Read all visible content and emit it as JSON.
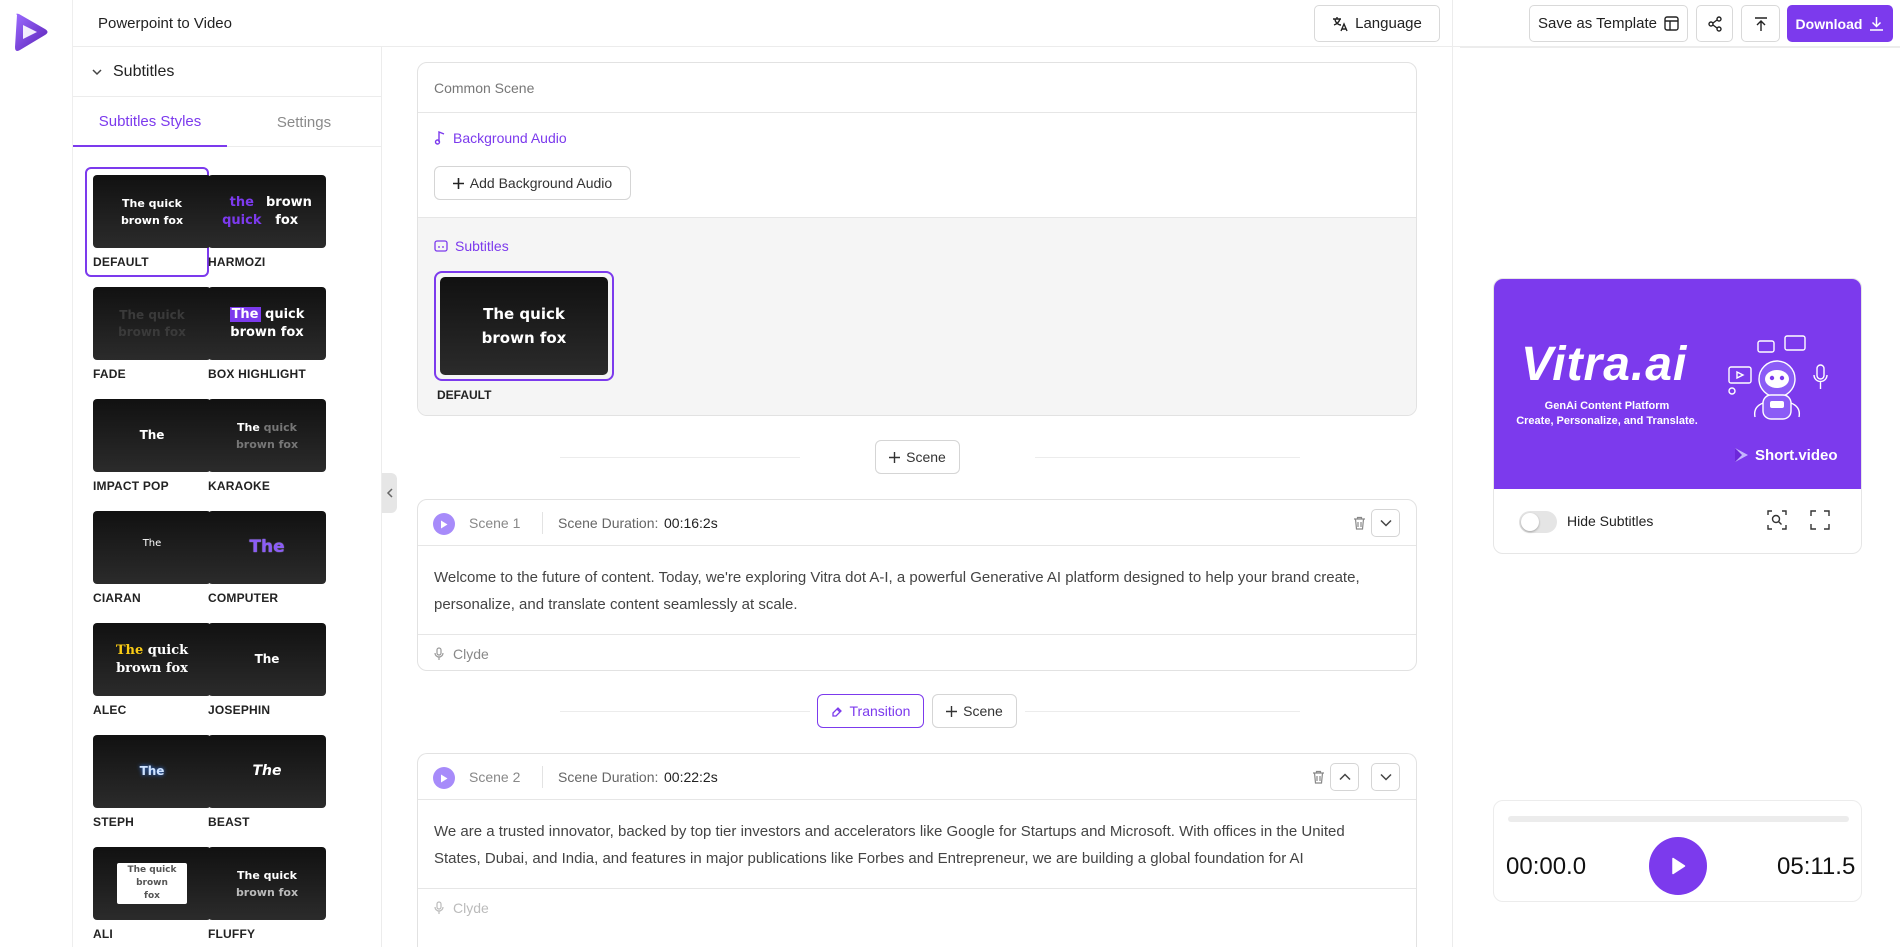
{
  "header": {
    "project_title": "Powerpoint to Video",
    "language_label": "Language",
    "save_template_label": "Save as Template",
    "download_label": "Download"
  },
  "left_panel": {
    "section_title": "Subtitles",
    "tabs": [
      {
        "label": "Subtitles Styles",
        "active": true
      },
      {
        "label": "Settings",
        "active": false
      }
    ],
    "styles": [
      {
        "name": "DEFAULT",
        "preview": "The quick brown fox",
        "selected": true
      },
      {
        "name": "HARMOZI",
        "preview": "the quick brown fox"
      },
      {
        "name": "FADE",
        "preview": "The quick brown fox"
      },
      {
        "name": "BOX HIGHLIGHT",
        "preview": "The quick brown fox"
      },
      {
        "name": "IMPACT POP",
        "preview": "The"
      },
      {
        "name": "KARAOKE",
        "preview": "The quick brown fox"
      },
      {
        "name": "CIARAN",
        "preview": "The"
      },
      {
        "name": "COMPUTER",
        "preview": "The"
      },
      {
        "name": "ALEC",
        "preview": "The quick brown fox"
      },
      {
        "name": "JOSEPHIN",
        "preview": "The"
      },
      {
        "name": "STEPH",
        "preview": "The"
      },
      {
        "name": "BEAST",
        "preview": "The"
      },
      {
        "name": "ALI",
        "preview": "The quick brown fox"
      },
      {
        "name": "FLUFFY",
        "preview": "The quick brown fox"
      }
    ]
  },
  "common_scene": {
    "title": "Common Scene",
    "background_audio_label": "Background Audio",
    "add_audio_label": "Add Background Audio",
    "subtitles_label": "Subtitles",
    "selected_style_preview": "The quick brown fox",
    "selected_style_name": "DEFAULT"
  },
  "add_scene_label": "Scene",
  "transition_label": "Transition",
  "scenes": [
    {
      "name": "Scene 1",
      "duration_label": "Scene Duration:",
      "duration": "00:16:2s",
      "text": "Welcome to the future of content. Today, we're exploring Vitra dot A-I, a powerful Generative AI platform designed to help your brand create, personalize, and translate content seamlessly at scale.",
      "voice": "Clyde"
    },
    {
      "name": "Scene 2",
      "duration_label": "Scene Duration:",
      "duration": "00:22:2s",
      "text": "We are a trusted innovator, backed by top tier investors and accelerators like Google for Startups and Microsoft. With offices in the United States, Dubai, and India, and features in major publications like Forbes and Entrepreneur, we are building a global foundation for AI",
      "voice": "Clyde"
    }
  ],
  "preview": {
    "brand": "Vitra.ai",
    "tagline_1": "GenAi Content Platform",
    "tagline_2": "Create, Personalize, and Translate.",
    "partner": "Short.video",
    "hide_subtitles_label": "Hide Subtitles",
    "hide_subtitles_on": false
  },
  "player": {
    "current_time": "00:00.0",
    "total_time": "05:11.5",
    "progress": 0
  },
  "colors": {
    "accent": "#7c3aed",
    "accent_light": "#a78bfa"
  }
}
